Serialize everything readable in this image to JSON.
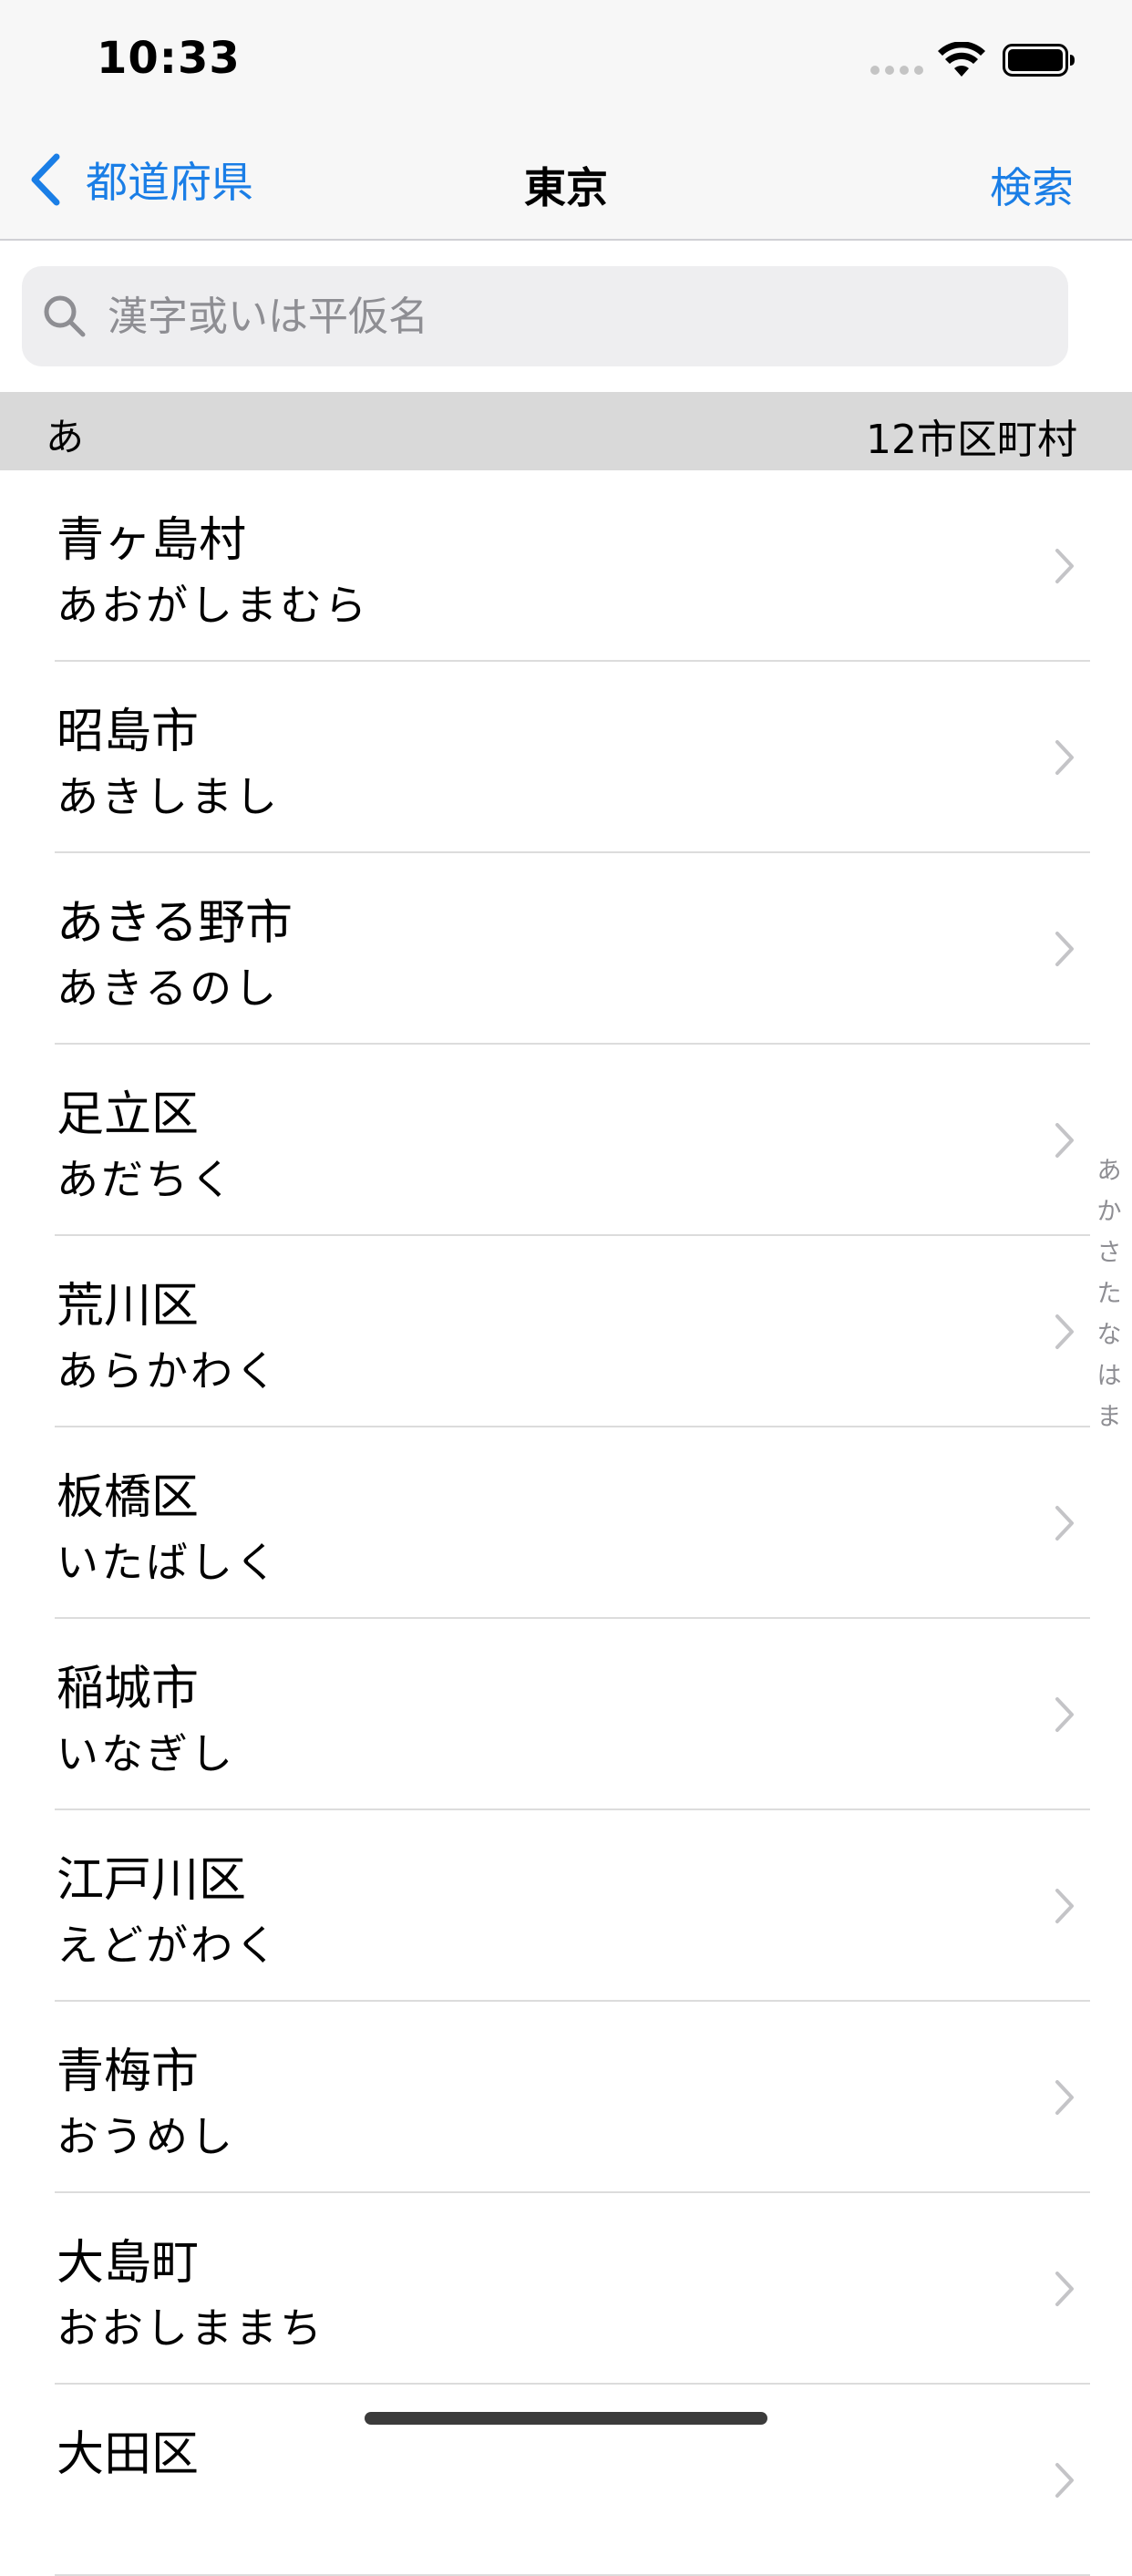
{
  "status_bar": {
    "time": "10:33"
  },
  "nav": {
    "back_label": "都道府県",
    "title": "東京",
    "search_label": "検索"
  },
  "search": {
    "value": "",
    "placeholder": "漢字或いは平仮名"
  },
  "section": {
    "letter": "あ",
    "count": "12市区町村"
  },
  "items": [
    {
      "name": "青ヶ島村",
      "reading": "あおがしまむら"
    },
    {
      "name": "昭島市",
      "reading": "あきしまし"
    },
    {
      "name": "あきる野市",
      "reading": "あきるのし"
    },
    {
      "name": "足立区",
      "reading": "あだちく"
    },
    {
      "name": "荒川区",
      "reading": "あらかわく"
    },
    {
      "name": "板橋区",
      "reading": "いたばしく"
    },
    {
      "name": "稲城市",
      "reading": "いなぎし"
    },
    {
      "name": "江戸川区",
      "reading": "えどがわく"
    },
    {
      "name": "青梅市",
      "reading": "おうめし"
    },
    {
      "name": "大島町",
      "reading": "おおしままち"
    },
    {
      "name": "大田区",
      "reading": ""
    }
  ],
  "section_index": [
    "あ",
    "か",
    "さ",
    "た",
    "な",
    "は",
    "ま"
  ],
  "colors": {
    "accent": "#1a7ee6",
    "bar_background": "#f7f7f7",
    "section_header": "#d9d9d9",
    "chevron": "#c4c4c7"
  },
  "icons": {
    "back": "chevron-left-icon",
    "search": "magnifier-icon",
    "row": "chevron-right-icon"
  }
}
